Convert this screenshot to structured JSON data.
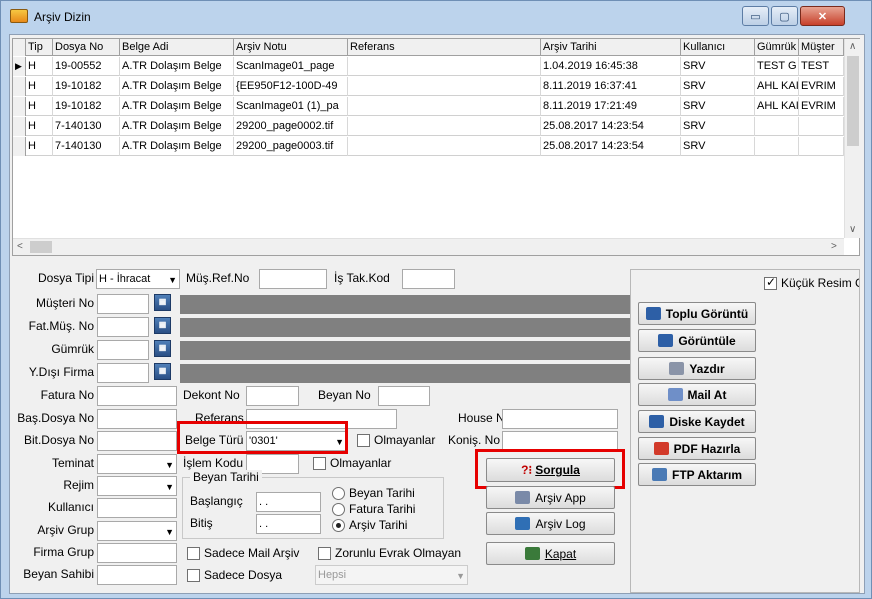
{
  "window": {
    "title": "Arşiv Dizin",
    "min": "▭",
    "max": "▢",
    "close": "✕"
  },
  "grid": {
    "columns": [
      "Tip",
      "Dosya No",
      "Belge Adi",
      "Arşiv Notu",
      "Referans",
      "Arşiv Tarihi",
      "Kullanıcı",
      "Gümrük",
      "Müşter"
    ],
    "rows": [
      [
        "H",
        "19-00552",
        "A.TR Dolaşım Belge",
        "ScanImage01_page",
        "",
        "1.04.2019 16:45:38",
        "SRV",
        "TEST G",
        "TEST"
      ],
      [
        "H",
        "19-10182",
        "A.TR Dolaşım Belge",
        "{EE950F12-100D-49",
        "",
        "8.11.2019 16:37:41",
        "SRV",
        "AHL KAI",
        "EVRIM"
      ],
      [
        "H",
        "19-10182",
        "A.TR Dolaşım Belge",
        "ScanImage01 (1)_pa",
        "",
        "8.11.2019 17:21:49",
        "SRV",
        "AHL KAI",
        "EVRIM"
      ],
      [
        "H",
        "7-140130",
        "A.TR Dolaşım Belge",
        "29200_page0002.tif",
        "",
        "25.08.2017 14:23:54",
        "SRV",
        "",
        ""
      ],
      [
        "H",
        "7-140130",
        "A.TR Dolaşım Belge",
        "29200_page0003.tif",
        "",
        "25.08.2017 14:23:54",
        "SRV",
        "",
        ""
      ]
    ],
    "selected_marker": "▶"
  },
  "form": {
    "dosya_tipi_label": "Dosya Tipi",
    "dosya_tipi_value": "H - İhracat",
    "mus_ref_label": "Müş.Ref.No",
    "is_tak_label": "İş Tak.Kod",
    "musteri_no_label": "Müşteri No",
    "fat_mus_label": "Fat.Müş. No",
    "gumruk_label": "Gümrük",
    "ydisi_label": "Y.Dışı Firma",
    "fatura_label": "Fatura No",
    "dekont_label": "Dekont No",
    "beyan_no_label": "Beyan No",
    "bas_dosya_label": "Baş.Dosya No",
    "referans_label": "Referans",
    "house_label": "House No",
    "bit_dosya_label": "Bit.Dosya No",
    "belge_turu_label": "Belge Türü",
    "belge_turu_value": "'0301'",
    "olmayanlar1": "Olmayanlar",
    "konis_label": "Koniş. No",
    "teminat_label": "Teminat",
    "islem_label": "İşlem Kodu",
    "olmayanlar2": "Olmayanlar",
    "rejim_label": "Rejim",
    "beyan_tarihi_label": "Beyan Tarihi",
    "kullanici_label": "Kullanıcı",
    "baslangic_label": "Başlangıç",
    "baslangic_value": " . .",
    "bitis_label": "Bitiş",
    "bitis_value": " . .",
    "radio_beyan": "Beyan Tarihi",
    "radio_fatura": "Fatura Tarihi",
    "radio_arsiv": "Arşiv Tarihi",
    "arsiv_grup_label": "Arşiv Grup",
    "firma_grup_label": "Firma Grup",
    "beyan_sahibi_label": "Beyan Sahibi",
    "sadece_mail": "Sadece Mail Arşiv",
    "zorunlu": "Zorunlu Evrak Olmayan",
    "sadece_dosya": "Sadece Dosya",
    "hepsi": "Hepsi",
    "kucuk_resim": "Küçük Resim G"
  },
  "buttons": {
    "sorgula": "Sorgula",
    "arsiv_app": "Arşiv App",
    "arsiv_log": "Arşiv Log",
    "kapat": "Kapat",
    "toplu": "Toplu Görüntü",
    "goruntule": "Görüntüle",
    "yazdir": "Yazdır",
    "mail": "Mail At",
    "diske": "Diske Kaydet",
    "pdf": "PDF Hazırla",
    "ftp": "FTP Aktarım"
  },
  "colors": {
    "highlight": "#e60000",
    "titlebar": "#bcd3ec",
    "disabled_field": "#808080"
  }
}
